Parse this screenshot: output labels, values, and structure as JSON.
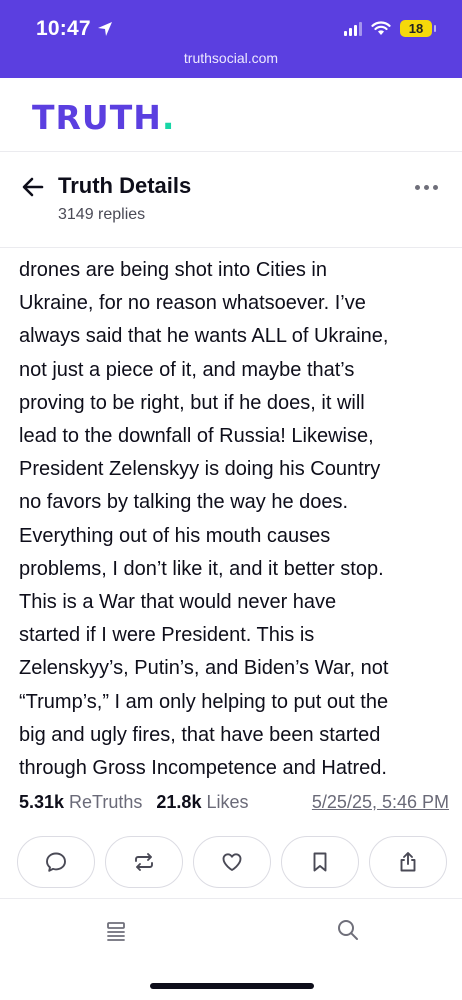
{
  "status_bar": {
    "time": "10:47",
    "battery": "18",
    "url": "truthsocial.com"
  },
  "header": {
    "logo_text": "TRUTH",
    "logo_dot": ".",
    "brand_color": "#5b3fe0",
    "accent_color": "#17d6a6"
  },
  "detail": {
    "title": "Truth Details",
    "replies": "3149 replies"
  },
  "post": {
    "text": "drones are being shot into Cities in\nUkraine, for no reason whatsoever. I’ve\nalways said that he wants ALL of Ukraine,\nnot just a piece of it, and maybe that’s\nproving to be right, but if he does, it will\nlead to the downfall of Russia! Likewise,\nPresident Zelenskyy is doing his Country\nno favors by talking the way he does.\nEverything out of his mouth causes\nproblems, I don’t like it, and it better stop.\nThis is a War that would never have\nstarted if I were President. This is\nZelenskyy’s, Putin’s, and Biden’s War, not\n“Trump’s,” I am only helping to put out the\nbig and ugly fires, that have been started\nthrough Gross Incompetence and Hatred.",
    "retruths_count": "5.31k",
    "retruths_label": "ReTruths",
    "likes_count": "21.8k",
    "likes_label": "Likes",
    "timestamp": "5/25/25, 5:46 PM"
  },
  "actions": [
    {
      "icon": "reply-icon"
    },
    {
      "icon": "retruth-icon"
    },
    {
      "icon": "heart-icon"
    },
    {
      "icon": "bookmark-icon"
    },
    {
      "icon": "share-icon"
    }
  ],
  "bottom_nav": [
    {
      "icon": "feed-icon"
    },
    {
      "icon": "search-icon"
    }
  ]
}
